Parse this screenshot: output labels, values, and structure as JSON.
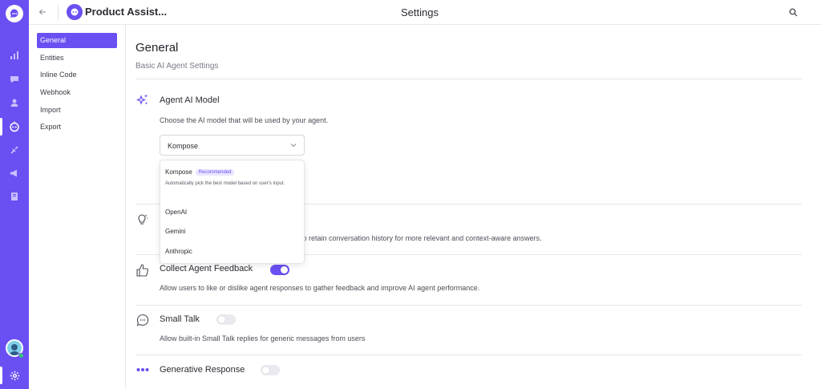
{
  "header": {
    "agent_name": "Product Assist...",
    "page_title": "Settings"
  },
  "submenu": {
    "items": [
      {
        "label": "General",
        "active": true
      },
      {
        "label": "Entities",
        "active": false
      },
      {
        "label": "Inline Code",
        "active": false
      },
      {
        "label": "Webhook",
        "active": false
      },
      {
        "label": "Import",
        "active": false
      },
      {
        "label": "Export",
        "active": false
      }
    ]
  },
  "main": {
    "title": "General",
    "subtitle": "Basic AI Agent Settings",
    "ai_model": {
      "title": "Agent AI Model",
      "description": "Choose the AI model that will be used by your agent.",
      "selected": "Kompose",
      "options": [
        {
          "label": "Kompose",
          "badge": "Recommended",
          "description": "Automatically pick the best model based on user's input."
        },
        {
          "label": "OpenAI"
        },
        {
          "label": "Gemini"
        },
        {
          "label": "Anthropic"
        }
      ]
    },
    "memory": {
      "description_visible": "t to retain conversation history for more relevant and context-aware answers."
    },
    "feedback": {
      "title": "Collect Agent Feedback",
      "description": "Allow users to like or dislike agent responses to gather feedback and improve AI agent performance.",
      "enabled": true
    },
    "small_talk": {
      "title": "Small Talk",
      "description": "Allow built-in Small Talk replies for generic messages from users",
      "enabled": false
    },
    "generative": {
      "title": "Generative Response",
      "enabled": false
    }
  },
  "colors": {
    "accent": "#6a4ff2",
    "toggle_off": "#e9e9ef"
  }
}
